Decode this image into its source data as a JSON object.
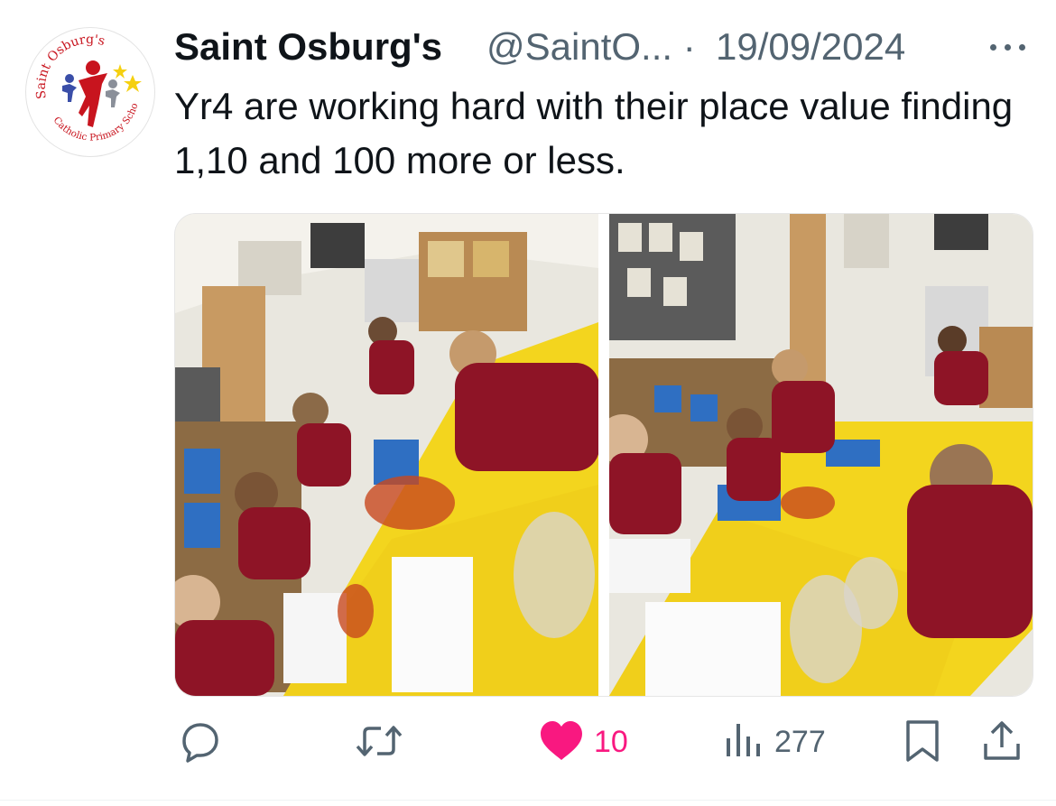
{
  "avatar": {
    "arc_top": "Saint Osburg's",
    "arc_bottom": "Catholic Primary School",
    "colors": {
      "red": "#c8141e",
      "blue": "#3a4ea8",
      "grey": "#8a8f99",
      "star": "#f5d010"
    }
  },
  "tweet": {
    "author_name": "Saint Osburg's",
    "handle": "@SaintO...",
    "separator": "·",
    "date": "19/09/2024",
    "text": "Yr4 are working hard with their place value finding 1,10 and 100 more or less."
  },
  "media": {
    "photo_count": 2,
    "colors": {
      "table": "#f3d51e",
      "jumper": "#8e1426",
      "wall": "#e9e7df",
      "tray": "#2f6fc2"
    }
  },
  "actions": {
    "reply": {
      "icon": "reply-icon",
      "count": ""
    },
    "retweet": {
      "icon": "retweet-icon",
      "count": ""
    },
    "like": {
      "icon": "heart-icon",
      "count": "10",
      "color": "#f91880"
    },
    "views": {
      "icon": "views-icon",
      "count": "277"
    },
    "bookmark": {
      "icon": "bookmark-icon"
    },
    "share": {
      "icon": "share-icon"
    }
  },
  "colors": {
    "text": "#0f1419",
    "secondary": "#536471",
    "like": "#f91880"
  }
}
